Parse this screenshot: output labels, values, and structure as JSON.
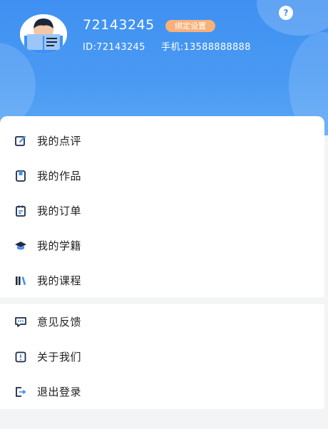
{
  "profile": {
    "username": "72143245",
    "bind_button": "绑定设置",
    "id_text": "ID:72143245",
    "phone_text": "手机:13588888888",
    "help_icon_glyph": "?"
  },
  "menu_group1": [
    {
      "label": "我的点评",
      "icon": "edit-icon"
    },
    {
      "label": "我的作品",
      "icon": "bookmark-icon"
    },
    {
      "label": "我的订单",
      "icon": "clipboard-icon"
    },
    {
      "label": "我的学籍",
      "icon": "graduation-cap-icon"
    },
    {
      "label": "我的课程",
      "icon": "books-icon"
    }
  ],
  "menu_group2": [
    {
      "label": "意见反馈",
      "icon": "feedback-icon"
    },
    {
      "label": "关于我们",
      "icon": "info-icon"
    },
    {
      "label": "退出登录",
      "icon": "logout-icon"
    }
  ],
  "colors": {
    "header_blue": "#3f90f2",
    "bind_orange": "#f7b179",
    "icon_dark": "#1f2a44",
    "icon_blue": "#3f90f2"
  }
}
